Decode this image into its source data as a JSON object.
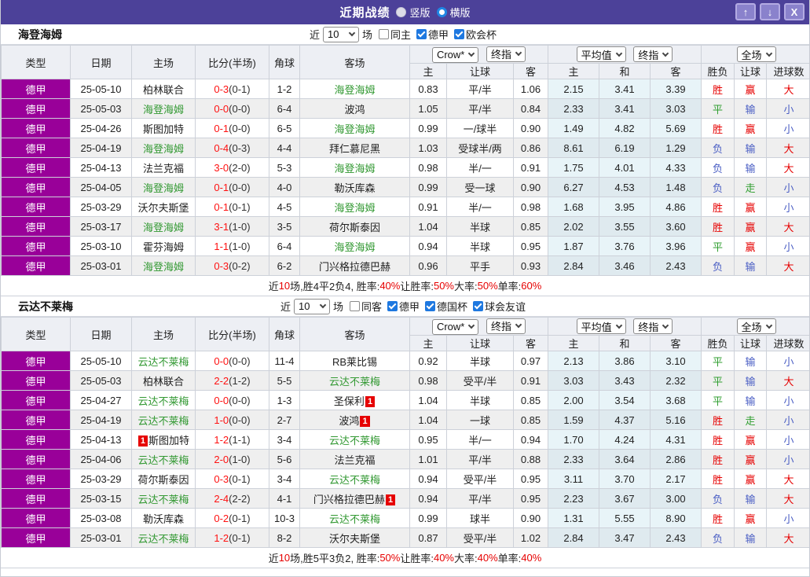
{
  "title_bar": {
    "title": "近期战绩",
    "vertical_label": "竖版",
    "vertical_checked": false,
    "horizontal_label": "横版",
    "horizontal_checked": true,
    "up_glyph": "↑",
    "down_glyph": "↓",
    "close_glyph": "X"
  },
  "colors": {
    "accent_purple": "#4c4199",
    "league_badge_bg": "#990099",
    "team_highlight": "#339933",
    "score_red": "#ff1111",
    "win_red": "#e60000",
    "draw_green": "#2f9e2f",
    "lose_blue": "#4a5ec4",
    "checkbox_blue": "#1e78e0"
  },
  "result_color_map": {
    "胜": "red",
    "平": "green",
    "负": "blue",
    "赢": "red",
    "走": "green",
    "输": "blue",
    "大": "red",
    "小": "blue"
  },
  "table_header": {
    "cols": [
      "类型",
      "日期",
      "主场",
      "比分(半场)",
      "角球",
      "客场"
    ],
    "group1": {
      "select1": "Crow*",
      "select2": "终指",
      "cols": [
        "主",
        "让球",
        "客"
      ]
    },
    "group2": {
      "select1": "平均值",
      "select2": "终指",
      "cols": [
        "主",
        "和",
        "客"
      ]
    },
    "group3": {
      "select1": "全场",
      "cols": [
        "胜负",
        "让球",
        "进球数"
      ]
    }
  },
  "sections": [
    {
      "team": "海登海姆",
      "filter": {
        "recent_label": "近",
        "count": "10",
        "unit_label": "场",
        "checkboxes": [
          {
            "label": "同主",
            "checked": false
          },
          {
            "label": "德甲",
            "checked": true
          },
          {
            "label": "欧会杯",
            "checked": true
          }
        ]
      },
      "rows": [
        {
          "league": "德甲",
          "date": "25-05-10",
          "home": {
            "name": "柏林联合",
            "highlight": false
          },
          "score_ft": "0-3",
          "score_ht": "(0-1)",
          "corner": "1-2",
          "away": {
            "name": "海登海姆",
            "highlight": true
          },
          "odds": {
            "home": "0.83",
            "handicap": "平/半",
            "away": "1.06"
          },
          "avg": {
            "home": "2.15",
            "draw": "3.41",
            "away": "3.39"
          },
          "result": {
            "outcome": "胜",
            "hcp_result": "赢",
            "goals": "大"
          }
        },
        {
          "league": "德甲",
          "date": "25-05-03",
          "home": {
            "name": "海登海姆",
            "highlight": true
          },
          "score_ft": "0-0",
          "score_ht": "(0-0)",
          "corner": "6-4",
          "away": {
            "name": "波鸿",
            "highlight": false
          },
          "odds": {
            "home": "1.05",
            "handicap": "平/半",
            "away": "0.84"
          },
          "avg": {
            "home": "2.33",
            "draw": "3.41",
            "away": "3.03"
          },
          "result": {
            "outcome": "平",
            "hcp_result": "输",
            "goals": "小"
          }
        },
        {
          "league": "德甲",
          "date": "25-04-26",
          "home": {
            "name": "斯图加特",
            "highlight": false
          },
          "score_ft": "0-1",
          "score_ht": "(0-0)",
          "corner": "6-5",
          "away": {
            "name": "海登海姆",
            "highlight": true
          },
          "odds": {
            "home": "0.99",
            "handicap": "一/球半",
            "away": "0.90"
          },
          "avg": {
            "home": "1.49",
            "draw": "4.82",
            "away": "5.69"
          },
          "result": {
            "outcome": "胜",
            "hcp_result": "赢",
            "goals": "小"
          }
        },
        {
          "league": "德甲",
          "date": "25-04-19",
          "home": {
            "name": "海登海姆",
            "highlight": true
          },
          "score_ft": "0-4",
          "score_ht": "(0-3)",
          "corner": "4-4",
          "away": {
            "name": "拜仁慕尼黑",
            "highlight": false
          },
          "odds": {
            "home": "1.03",
            "handicap": "受球半/两",
            "away": "0.86"
          },
          "avg": {
            "home": "8.61",
            "draw": "6.19",
            "away": "1.29"
          },
          "result": {
            "outcome": "负",
            "hcp_result": "输",
            "goals": "大"
          }
        },
        {
          "league": "德甲",
          "date": "25-04-13",
          "home": {
            "name": "法兰克福",
            "highlight": false
          },
          "score_ft": "3-0",
          "score_ht": "(2-0)",
          "corner": "5-3",
          "away": {
            "name": "海登海姆",
            "highlight": true
          },
          "odds": {
            "home": "0.98",
            "handicap": "半/一",
            "away": "0.91"
          },
          "avg": {
            "home": "1.75",
            "draw": "4.01",
            "away": "4.33"
          },
          "result": {
            "outcome": "负",
            "hcp_result": "输",
            "goals": "大"
          }
        },
        {
          "league": "德甲",
          "date": "25-04-05",
          "home": {
            "name": "海登海姆",
            "highlight": true
          },
          "score_ft": "0-1",
          "score_ht": "(0-0)",
          "corner": "4-0",
          "away": {
            "name": "勒沃库森",
            "highlight": false
          },
          "odds": {
            "home": "0.99",
            "handicap": "受一球",
            "away": "0.90"
          },
          "avg": {
            "home": "6.27",
            "draw": "4.53",
            "away": "1.48"
          },
          "result": {
            "outcome": "负",
            "hcp_result": "走",
            "goals": "小"
          }
        },
        {
          "league": "德甲",
          "date": "25-03-29",
          "home": {
            "name": "沃尔夫斯堡",
            "highlight": false
          },
          "score_ft": "0-1",
          "score_ht": "(0-1)",
          "corner": "4-5",
          "away": {
            "name": "海登海姆",
            "highlight": true
          },
          "odds": {
            "home": "0.91",
            "handicap": "半/一",
            "away": "0.98"
          },
          "avg": {
            "home": "1.68",
            "draw": "3.95",
            "away": "4.86"
          },
          "result": {
            "outcome": "胜",
            "hcp_result": "赢",
            "goals": "小"
          }
        },
        {
          "league": "德甲",
          "date": "25-03-17",
          "home": {
            "name": "海登海姆",
            "highlight": true
          },
          "score_ft": "3-1",
          "score_ht": "(1-0)",
          "corner": "3-5",
          "away": {
            "name": "荷尔斯泰因",
            "highlight": false
          },
          "odds": {
            "home": "1.04",
            "handicap": "半球",
            "away": "0.85"
          },
          "avg": {
            "home": "2.02",
            "draw": "3.55",
            "away": "3.60"
          },
          "result": {
            "outcome": "胜",
            "hcp_result": "赢",
            "goals": "大"
          }
        },
        {
          "league": "德甲",
          "date": "25-03-10",
          "home": {
            "name": "霍芬海姆",
            "highlight": false
          },
          "score_ft": "1-1",
          "score_ht": "(1-0)",
          "corner": "6-4",
          "away": {
            "name": "海登海姆",
            "highlight": true
          },
          "odds": {
            "home": "0.94",
            "handicap": "半球",
            "away": "0.95"
          },
          "avg": {
            "home": "1.87",
            "draw": "3.76",
            "away": "3.96"
          },
          "result": {
            "outcome": "平",
            "hcp_result": "赢",
            "goals": "小"
          }
        },
        {
          "league": "德甲",
          "date": "25-03-01",
          "home": {
            "name": "海登海姆",
            "highlight": true
          },
          "score_ft": "0-3",
          "score_ht": "(0-2)",
          "corner": "6-2",
          "away": {
            "name": "门兴格拉德巴赫",
            "highlight": false
          },
          "odds": {
            "home": "0.96",
            "handicap": "平手",
            "away": "0.93"
          },
          "avg": {
            "home": "2.84",
            "draw": "3.46",
            "away": "2.43"
          },
          "result": {
            "outcome": "负",
            "hcp_result": "输",
            "goals": "大"
          }
        }
      ],
      "summary_parts": [
        [
          "近",
          "d"
        ],
        [
          "10",
          "r"
        ],
        [
          "场,胜4平2负4, 胜率:",
          "d"
        ],
        [
          "40%",
          "r"
        ],
        [
          " 让胜率:",
          "d"
        ],
        [
          "50%",
          "r"
        ],
        [
          " 大率:",
          "d"
        ],
        [
          "50%",
          "r"
        ],
        [
          " 单率:",
          "d"
        ],
        [
          "60%",
          "r"
        ]
      ]
    },
    {
      "team": "云达不莱梅",
      "filter": {
        "recent_label": "近",
        "count": "10",
        "unit_label": "场",
        "checkboxes": [
          {
            "label": "同客",
            "checked": false
          },
          {
            "label": "德甲",
            "checked": true
          },
          {
            "label": "德国杯",
            "checked": true
          },
          {
            "label": "球会友谊",
            "checked": true
          }
        ]
      },
      "rows": [
        {
          "league": "德甲",
          "date": "25-05-10",
          "home": {
            "name": "云达不莱梅",
            "highlight": true
          },
          "score_ft": "0-0",
          "score_ht": "(0-0)",
          "corner": "11-4",
          "away": {
            "name": "RB莱比锡",
            "highlight": false
          },
          "odds": {
            "home": "0.92",
            "handicap": "半球",
            "away": "0.97"
          },
          "avg": {
            "home": "2.13",
            "draw": "3.86",
            "away": "3.10"
          },
          "result": {
            "outcome": "平",
            "hcp_result": "输",
            "goals": "小"
          }
        },
        {
          "league": "德甲",
          "date": "25-05-03",
          "home": {
            "name": "柏林联合",
            "highlight": false
          },
          "score_ft": "2-2",
          "score_ht": "(1-2)",
          "corner": "5-5",
          "away": {
            "name": "云达不莱梅",
            "highlight": true
          },
          "odds": {
            "home": "0.98",
            "handicap": "受平/半",
            "away": "0.91"
          },
          "avg": {
            "home": "3.03",
            "draw": "3.43",
            "away": "2.32"
          },
          "result": {
            "outcome": "平",
            "hcp_result": "输",
            "goals": "大"
          }
        },
        {
          "league": "德甲",
          "date": "25-04-27",
          "home": {
            "name": "云达不莱梅",
            "highlight": true
          },
          "score_ft": "0-0",
          "score_ht": "(0-0)",
          "corner": "1-3",
          "away": {
            "name": "圣保利",
            "highlight": false,
            "red_card": "1",
            "red_card_pos": "after"
          },
          "odds": {
            "home": "1.04",
            "handicap": "半球",
            "away": "0.85"
          },
          "avg": {
            "home": "2.00",
            "draw": "3.54",
            "away": "3.68"
          },
          "result": {
            "outcome": "平",
            "hcp_result": "输",
            "goals": "小"
          }
        },
        {
          "league": "德甲",
          "date": "25-04-19",
          "home": {
            "name": "云达不莱梅",
            "highlight": true
          },
          "score_ft": "1-0",
          "score_ht": "(0-0)",
          "corner": "2-7",
          "away": {
            "name": "波鸿",
            "highlight": false,
            "red_card": "1",
            "red_card_pos": "after"
          },
          "odds": {
            "home": "1.04",
            "handicap": "一球",
            "away": "0.85"
          },
          "avg": {
            "home": "1.59",
            "draw": "4.37",
            "away": "5.16"
          },
          "result": {
            "outcome": "胜",
            "hcp_result": "走",
            "goals": "小"
          }
        },
        {
          "league": "德甲",
          "date": "25-04-13",
          "home": {
            "name": "斯图加特",
            "highlight": false,
            "red_card": "1",
            "red_card_pos": "before"
          },
          "score_ft": "1-2",
          "score_ht": "(1-1)",
          "corner": "3-4",
          "away": {
            "name": "云达不莱梅",
            "highlight": true
          },
          "odds": {
            "home": "0.95",
            "handicap": "半/一",
            "away": "0.94"
          },
          "avg": {
            "home": "1.70",
            "draw": "4.24",
            "away": "4.31"
          },
          "result": {
            "outcome": "胜",
            "hcp_result": "赢",
            "goals": "小"
          }
        },
        {
          "league": "德甲",
          "date": "25-04-06",
          "home": {
            "name": "云达不莱梅",
            "highlight": true
          },
          "score_ft": "2-0",
          "score_ht": "(1-0)",
          "corner": "5-6",
          "away": {
            "name": "法兰克福",
            "highlight": false
          },
          "odds": {
            "home": "1.01",
            "handicap": "平/半",
            "away": "0.88"
          },
          "avg": {
            "home": "2.33",
            "draw": "3.64",
            "away": "2.86"
          },
          "result": {
            "outcome": "胜",
            "hcp_result": "赢",
            "goals": "小"
          }
        },
        {
          "league": "德甲",
          "date": "25-03-29",
          "home": {
            "name": "荷尔斯泰因",
            "highlight": false
          },
          "score_ft": "0-3",
          "score_ht": "(0-1)",
          "corner": "3-4",
          "away": {
            "name": "云达不莱梅",
            "highlight": true
          },
          "odds": {
            "home": "0.94",
            "handicap": "受平/半",
            "away": "0.95"
          },
          "avg": {
            "home": "3.11",
            "draw": "3.70",
            "away": "2.17"
          },
          "result": {
            "outcome": "胜",
            "hcp_result": "赢",
            "goals": "大"
          }
        },
        {
          "league": "德甲",
          "date": "25-03-15",
          "home": {
            "name": "云达不莱梅",
            "highlight": true
          },
          "score_ft": "2-4",
          "score_ht": "(2-2)",
          "corner": "4-1",
          "away": {
            "name": "门兴格拉德巴赫",
            "highlight": false,
            "red_card": "1",
            "red_card_pos": "after"
          },
          "odds": {
            "home": "0.94",
            "handicap": "平/半",
            "away": "0.95"
          },
          "avg": {
            "home": "2.23",
            "draw": "3.67",
            "away": "3.00"
          },
          "result": {
            "outcome": "负",
            "hcp_result": "输",
            "goals": "大"
          }
        },
        {
          "league": "德甲",
          "date": "25-03-08",
          "home": {
            "name": "勒沃库森",
            "highlight": false
          },
          "score_ft": "0-2",
          "score_ht": "(0-1)",
          "corner": "10-3",
          "away": {
            "name": "云达不莱梅",
            "highlight": true
          },
          "odds": {
            "home": "0.99",
            "handicap": "球半",
            "away": "0.90"
          },
          "avg": {
            "home": "1.31",
            "draw": "5.55",
            "away": "8.90"
          },
          "result": {
            "outcome": "胜",
            "hcp_result": "赢",
            "goals": "小"
          }
        },
        {
          "league": "德甲",
          "date": "25-03-01",
          "home": {
            "name": "云达不莱梅",
            "highlight": true
          },
          "score_ft": "1-2",
          "score_ht": "(0-1)",
          "corner": "8-2",
          "away": {
            "name": "沃尔夫斯堡",
            "highlight": false
          },
          "odds": {
            "home": "0.87",
            "handicap": "受平/半",
            "away": "1.02"
          },
          "avg": {
            "home": "2.84",
            "draw": "3.47",
            "away": "2.43"
          },
          "result": {
            "outcome": "负",
            "hcp_result": "输",
            "goals": "大"
          }
        }
      ],
      "summary_parts": [
        [
          "近",
          "d"
        ],
        [
          "10",
          "r"
        ],
        [
          "场,胜5平3负2, 胜率:",
          "d"
        ],
        [
          "50%",
          "r"
        ],
        [
          " 让胜率:",
          "d"
        ],
        [
          "40%",
          "r"
        ],
        [
          " 大率:",
          "d"
        ],
        [
          "40%",
          "r"
        ],
        [
          " 单率:",
          "d"
        ],
        [
          "40%",
          "r"
        ]
      ]
    }
  ]
}
